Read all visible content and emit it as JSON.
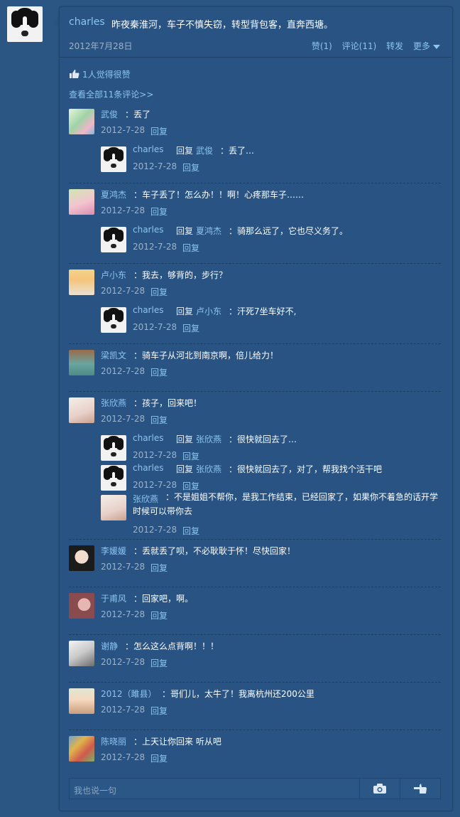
{
  "post": {
    "author": "charles",
    "text": "昨夜秦淮河，车子不慎失窃，转型背包客，直奔西塘。",
    "date": "2012年7月28日",
    "actions": {
      "like": "赞(1)",
      "comment": "评论(11)",
      "forward": "转发",
      "more": "更多"
    }
  },
  "likes": {
    "text": "1人觉得很赞"
  },
  "view_all": "查看全部11条评论>>",
  "reply_label": "回复",
  "reply_to_word": "回复",
  "comments": [
    {
      "name": "武俊",
      "text": "：丢了",
      "date": "2012-7-28",
      "replies": [
        {
          "name": "charles",
          "to": "武俊",
          "text": "：丢了…",
          "date": "2012-7-28"
        }
      ]
    },
    {
      "name": "夏鸿杰",
      "text": "：车子丢了！怎么办！！啊！心疼那车子……",
      "date": "2012-7-28",
      "replies": [
        {
          "name": "charles",
          "to": "夏鸿杰",
          "text": "：骑那么远了，它也尽义务了。",
          "date": "2012-7-28"
        }
      ]
    },
    {
      "name": "卢小东",
      "text": "：我去，够背的，步行？",
      "date": "2012-7-28",
      "replies": [
        {
          "name": "charles",
          "to": "卢小东",
          "text": "：汗死7坐车好不,",
          "date": "2012-7-28"
        }
      ]
    },
    {
      "name": "梁凯文",
      "text": "：骑车子从河北到南京啊，倍儿给力！",
      "date": "2012-7-28",
      "replies": []
    },
    {
      "name": "张欣燕",
      "text": "：孩子，回来吧！",
      "date": "2012-7-28",
      "replies": [
        {
          "name": "charles",
          "to": "张欣燕",
          "text": "：很快就回去了…",
          "date": "2012-7-28"
        },
        {
          "name": "charles",
          "to": "张欣燕",
          "text": "：很快就回去了，对了，帮我找个活干吧",
          "date": "2012-7-28"
        },
        {
          "name": "张欣燕",
          "text": "：不是姐姐不帮你，是我工作结束，已经回家了，如果你不着急的话开学时候可以带你去",
          "date": "2012-7-28"
        }
      ]
    },
    {
      "name": "李媛媛",
      "text": "：丢就丢了呗，不必耿耿于怀！尽快回家！",
      "date": "2012-7-28",
      "replies": []
    },
    {
      "name": "于甫风",
      "text": "：回家吧，啊。",
      "date": "2012-7-28",
      "replies": []
    },
    {
      "name": "谢静",
      "text": "：怎么这么点背啊！！！",
      "date": "2012-7-28",
      "replies": []
    },
    {
      "name": "2012（雎县）",
      "text": "：哥们儿，太牛了！我离杭州还200公里",
      "date": "2012-7-28",
      "replies": []
    },
    {
      "name": "陈晓丽",
      "text": "：上天让你回来 听从吧",
      "date": "2012-7-28",
      "replies": []
    }
  ],
  "input": {
    "placeholder": "我也说一句"
  },
  "icons": {
    "more": "chevron-down-icon",
    "like": "thumbs-up-icon",
    "camera": "camera-icon",
    "poke": "pointing-hand-icon"
  },
  "colors": {
    "background": "#2b5583",
    "link": "#8cc4f2",
    "text": "#ffffff",
    "muted": "#9bb3cc"
  }
}
